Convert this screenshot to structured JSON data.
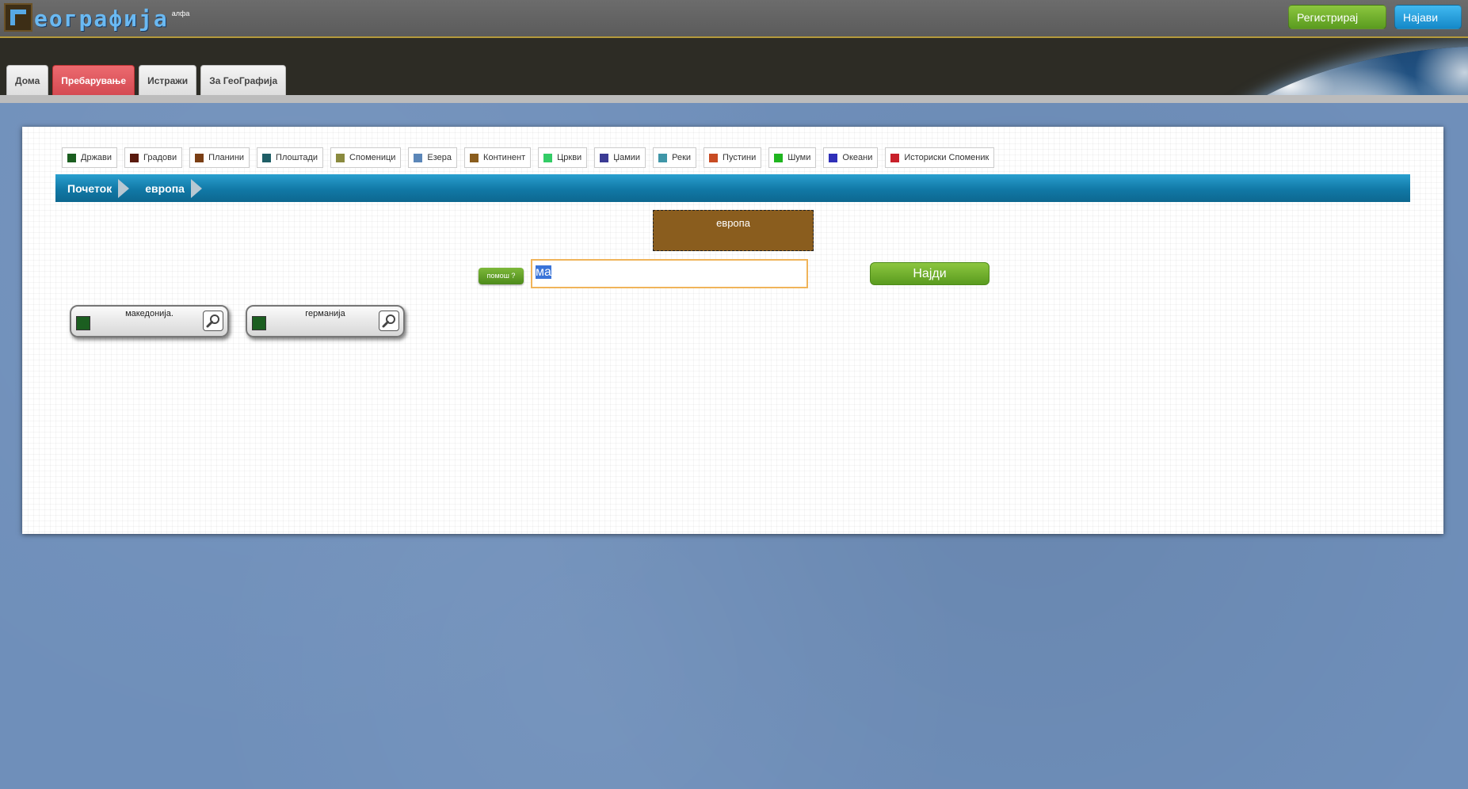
{
  "app": {
    "logo_text": "еографија",
    "logo_badge": "алфа",
    "register_label": "Регистрирај Се!",
    "login_label": "Најави Се"
  },
  "nav": {
    "tabs": [
      {
        "label": "Дома",
        "active": false
      },
      {
        "label": "Пребарување",
        "active": true
      },
      {
        "label": "Истражи",
        "active": false
      },
      {
        "label": "За ГеоГрафија",
        "active": false
      }
    ]
  },
  "legend": [
    {
      "label": "Држави",
      "color": "#1b5e20"
    },
    {
      "label": "Градови",
      "color": "#5a1a0e"
    },
    {
      "label": "Планини",
      "color": "#7a3e14"
    },
    {
      "label": "Плоштади",
      "color": "#1f5e66"
    },
    {
      "label": "Споменици",
      "color": "#8a8a3e"
    },
    {
      "label": "Езера",
      "color": "#5b86b8"
    },
    {
      "label": "Континент",
      "color": "#8a5d1e"
    },
    {
      "label": "Цркви",
      "color": "#33cc66"
    },
    {
      "label": "Џамии",
      "color": "#3b3b94"
    },
    {
      "label": "Реки",
      "color": "#3f96a8"
    },
    {
      "label": "Пустини",
      "color": "#c84b23"
    },
    {
      "label": "Шуми",
      "color": "#1fb51f"
    },
    {
      "label": "Океани",
      "color": "#2f2fb8"
    },
    {
      "label": "Историски Споменик",
      "color": "#c8202a"
    }
  ],
  "breadcrumb": [
    "Почеток",
    "европа"
  ],
  "continent_box": {
    "label": "европа"
  },
  "search": {
    "help_label": "помош ?",
    "value": "ма",
    "find_label": "Најди"
  },
  "results": [
    {
      "name": "македонија."
    },
    {
      "name": "германија"
    }
  ]
}
